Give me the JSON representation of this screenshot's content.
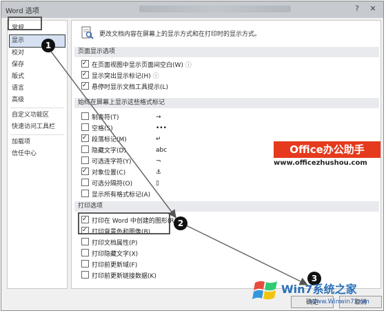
{
  "window": {
    "title": "Word 选项",
    "help_label": "?",
    "close_label": "✕"
  },
  "sidebar": {
    "items": [
      "常规",
      "显示",
      "校对",
      "保存",
      "版式",
      "语言",
      "高级",
      "自定义功能区",
      "快速访问工具栏",
      "加载项",
      "信任中心"
    ],
    "active": "显示"
  },
  "main": {
    "description": "更改文档内容在屏幕上的显示方式和在打印时的显示方式。",
    "page_section": {
      "header": "页面显示选项",
      "options": [
        {
          "label": "在页面视图中显示页面间空白(W)",
          "checked": true
        },
        {
          "label": "显示突出显示标记(H)",
          "checked": true
        },
        {
          "label": "悬停时显示文档工具提示(L)",
          "checked": true
        }
      ]
    },
    "marks_section": {
      "header": "始终在屏幕上显示这些格式标记",
      "options": [
        {
          "label": "制表符(T)",
          "symbol": "→",
          "checked": false
        },
        {
          "label": "空格(S)",
          "symbol": "•••",
          "checked": false
        },
        {
          "label": "段落标记(M)",
          "symbol": "↵",
          "checked": true
        },
        {
          "label": "隐藏文字(D)",
          "symbol": "abc",
          "checked": false
        },
        {
          "label": "可选连字符(Y)",
          "symbol": "¬",
          "checked": false
        },
        {
          "label": "对象位置(C)",
          "symbol": "⚓",
          "checked": true
        },
        {
          "label": "可选分隔符(O)",
          "symbol": "▯",
          "checked": false
        },
        {
          "label": "显示所有格式标记(A)",
          "symbol": "",
          "checked": false
        }
      ]
    },
    "print_section": {
      "header": "打印选项",
      "options": [
        {
          "label": "打印在 Word 中创建的图形(R)",
          "checked": true
        },
        {
          "label": "打印背景色和图像(B)",
          "checked": true
        },
        {
          "label": "打印文档属性(P)",
          "checked": false
        },
        {
          "label": "打印隐藏文字(X)",
          "checked": false
        },
        {
          "label": "打印前更新域(F)",
          "checked": false
        },
        {
          "label": "打印前更新链接数据(K)",
          "checked": false
        }
      ]
    }
  },
  "buttons": {
    "ok": "确定",
    "cancel": "取消"
  },
  "callouts": [
    "1",
    "2",
    "3"
  ],
  "watermarks": {
    "office_brand": "Office办公助手",
    "office_url": "www.officezhushou.com",
    "win7_brand": "Win7系统之家",
    "win7_url": "Www.Winwin7.com"
  },
  "colors": {
    "office_red": "#e53a1d",
    "active_blue": "#d5e1f2",
    "section_gray": "#e8eaee"
  }
}
